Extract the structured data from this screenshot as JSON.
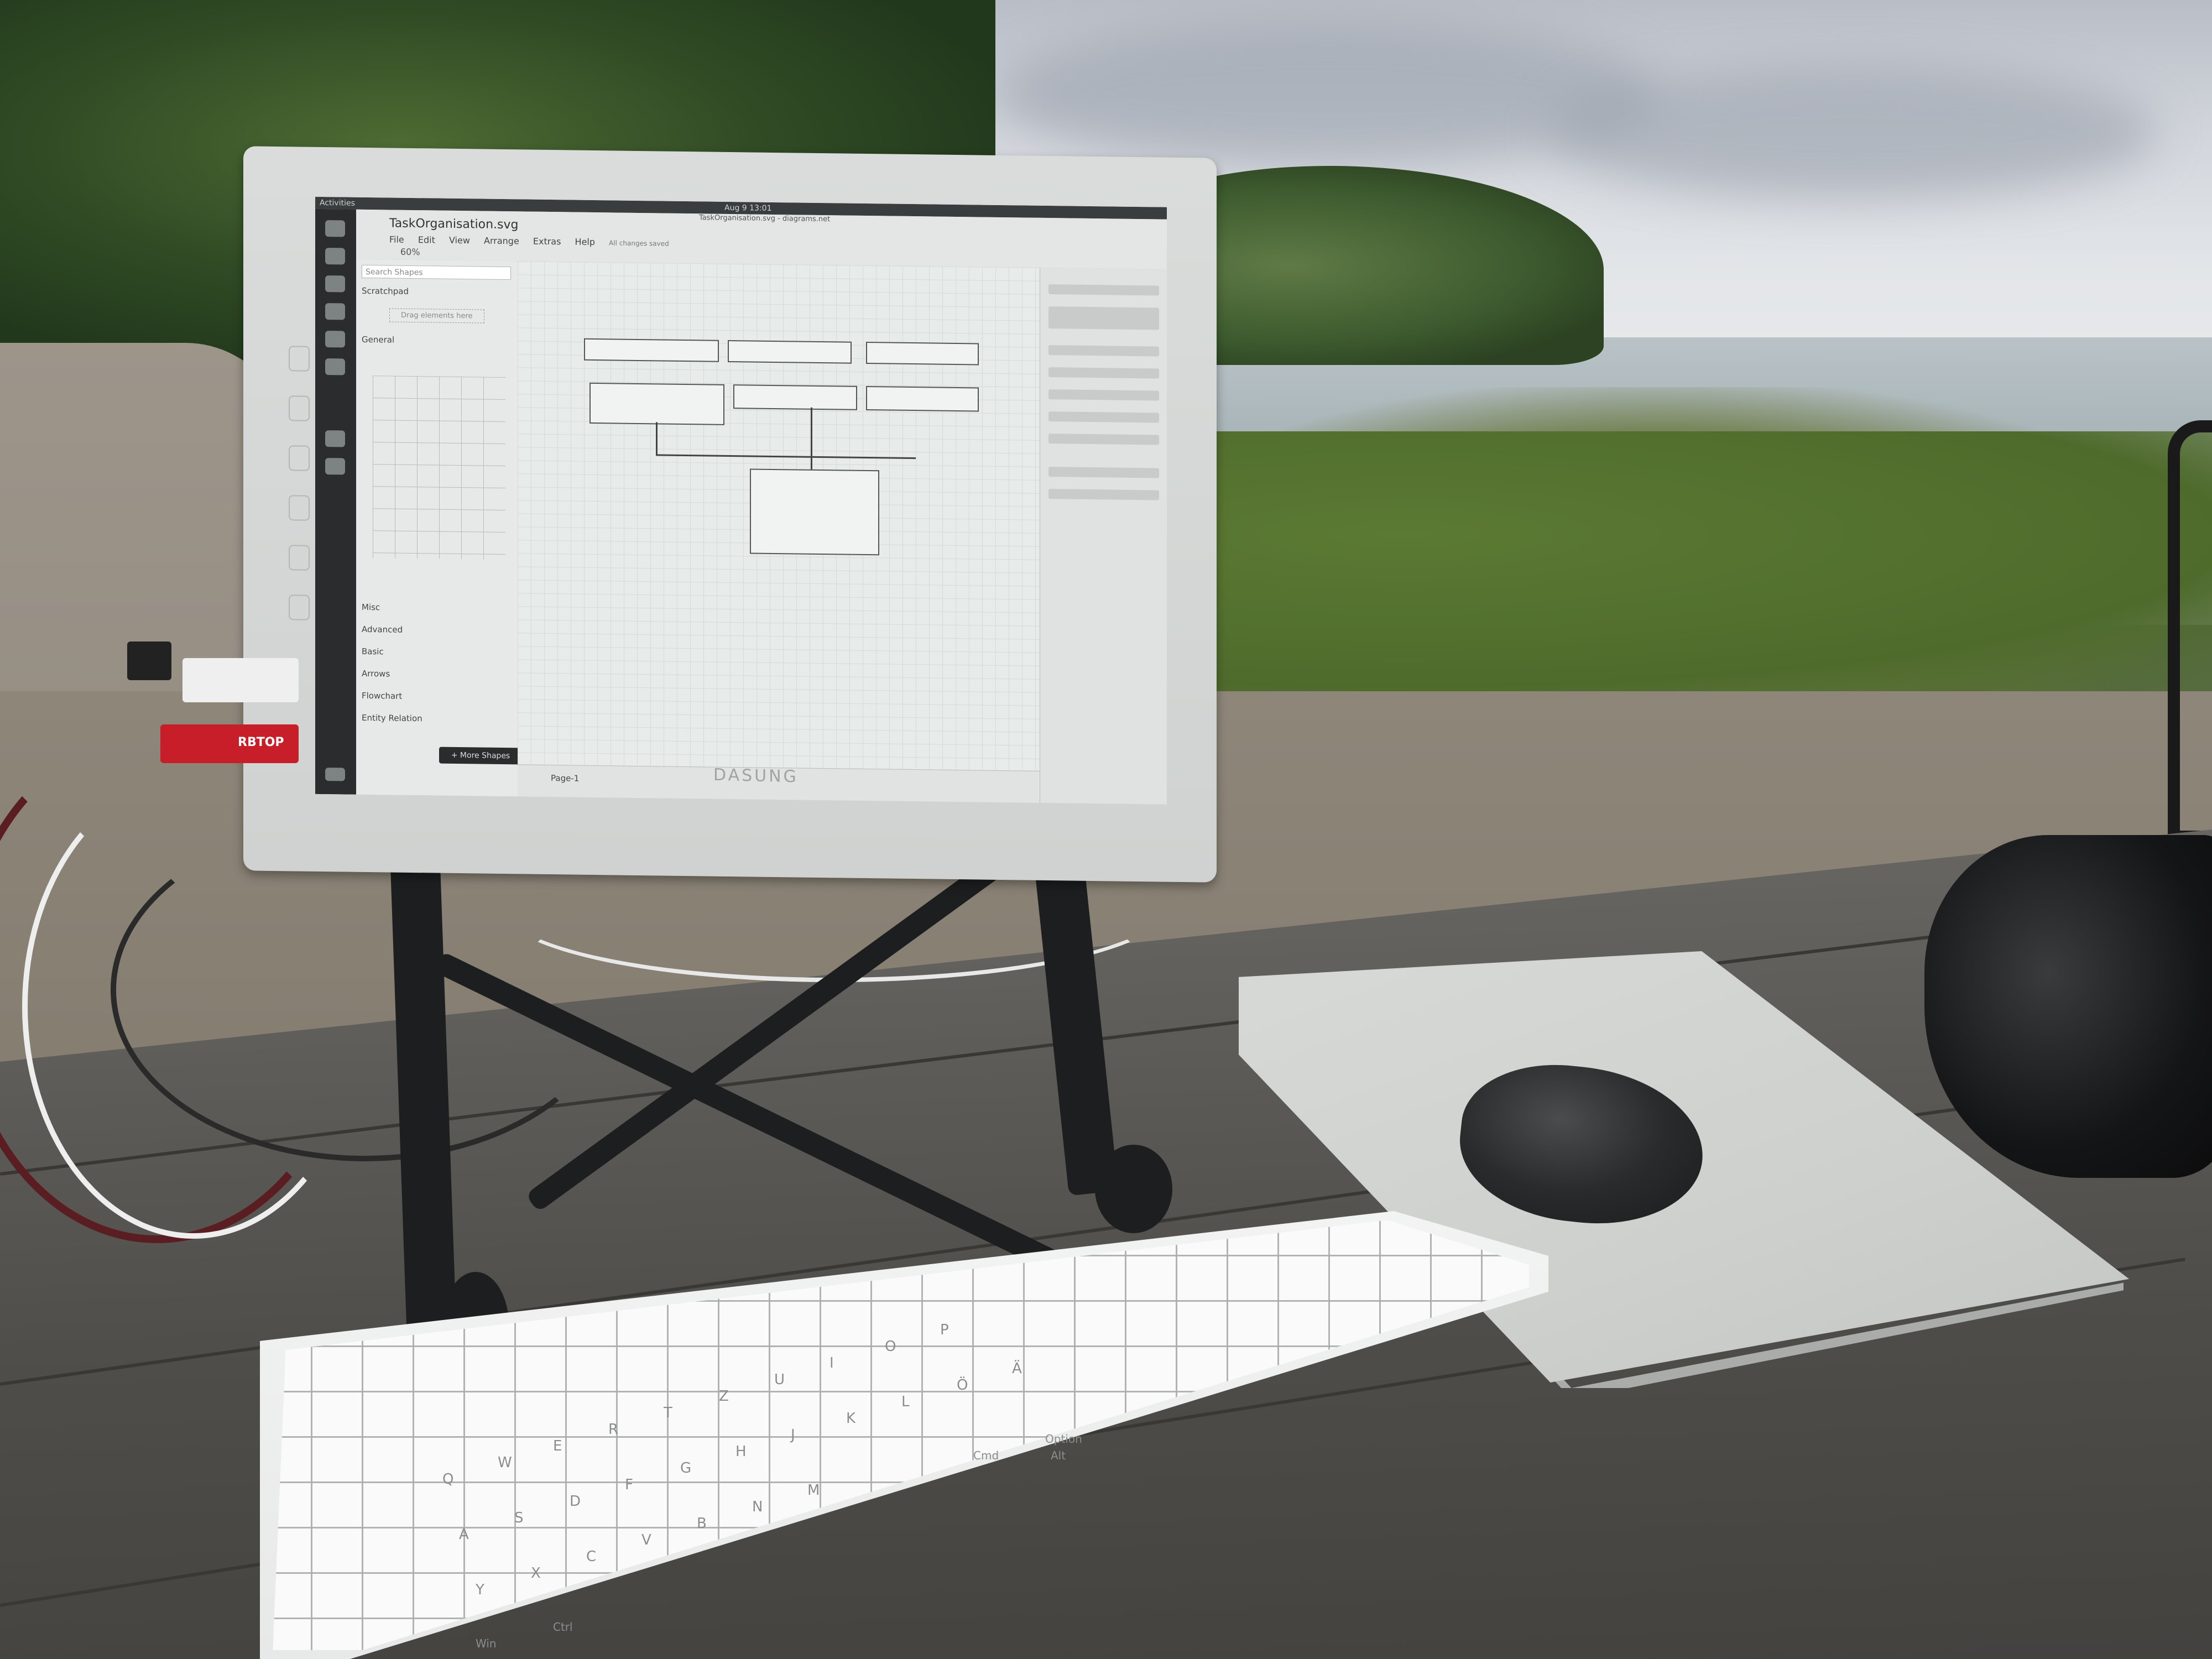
{
  "scene": {
    "description_colors": {
      "sky": "#d2d6dc",
      "lake": "#a6b2b5",
      "grass": "#4f6b2c",
      "table": "#5d5b57",
      "monitor_bezel": "#d9dcda"
    }
  },
  "monitor": {
    "brand": "DASUNG",
    "screen": {
      "topbar": {
        "left": "Activities",
        "center": "Aug 9  13:01"
      },
      "app": {
        "title": "TaskOrganisation.svg",
        "window_title": "TaskOrganisation.svg - diagrams.net",
        "menu": [
          "File",
          "Edit",
          "View",
          "Arrange",
          "Extras",
          "Help"
        ],
        "menu_status": "All changes saved",
        "zoom": "60%"
      },
      "shapes_panel": {
        "search_placeholder": "Search Shapes",
        "scratchpad": "Scratchpad",
        "drag_hint": "Drag elements here",
        "sections": [
          "General",
          "Misc",
          "Advanced",
          "Basic",
          "Arrows",
          "Flowchart",
          "Entity Relation"
        ],
        "more_shapes": "+ More Shapes"
      },
      "page_tab": "Page-1"
    }
  },
  "cables": {
    "labels": [
      "RBTOP"
    ]
  },
  "keyboard": {
    "visible_keys": [
      "Q",
      "W",
      "E",
      "R",
      "T",
      "Z",
      "U",
      "I",
      "O",
      "P",
      "A",
      "S",
      "D",
      "F",
      "G",
      "H",
      "J",
      "K",
      "L",
      "Ö",
      "Ä",
      "Y",
      "X",
      "C",
      "V",
      "B",
      "N",
      "M",
      "Cmd",
      "Option",
      "Alt",
      "Win",
      "Ctrl"
    ]
  }
}
